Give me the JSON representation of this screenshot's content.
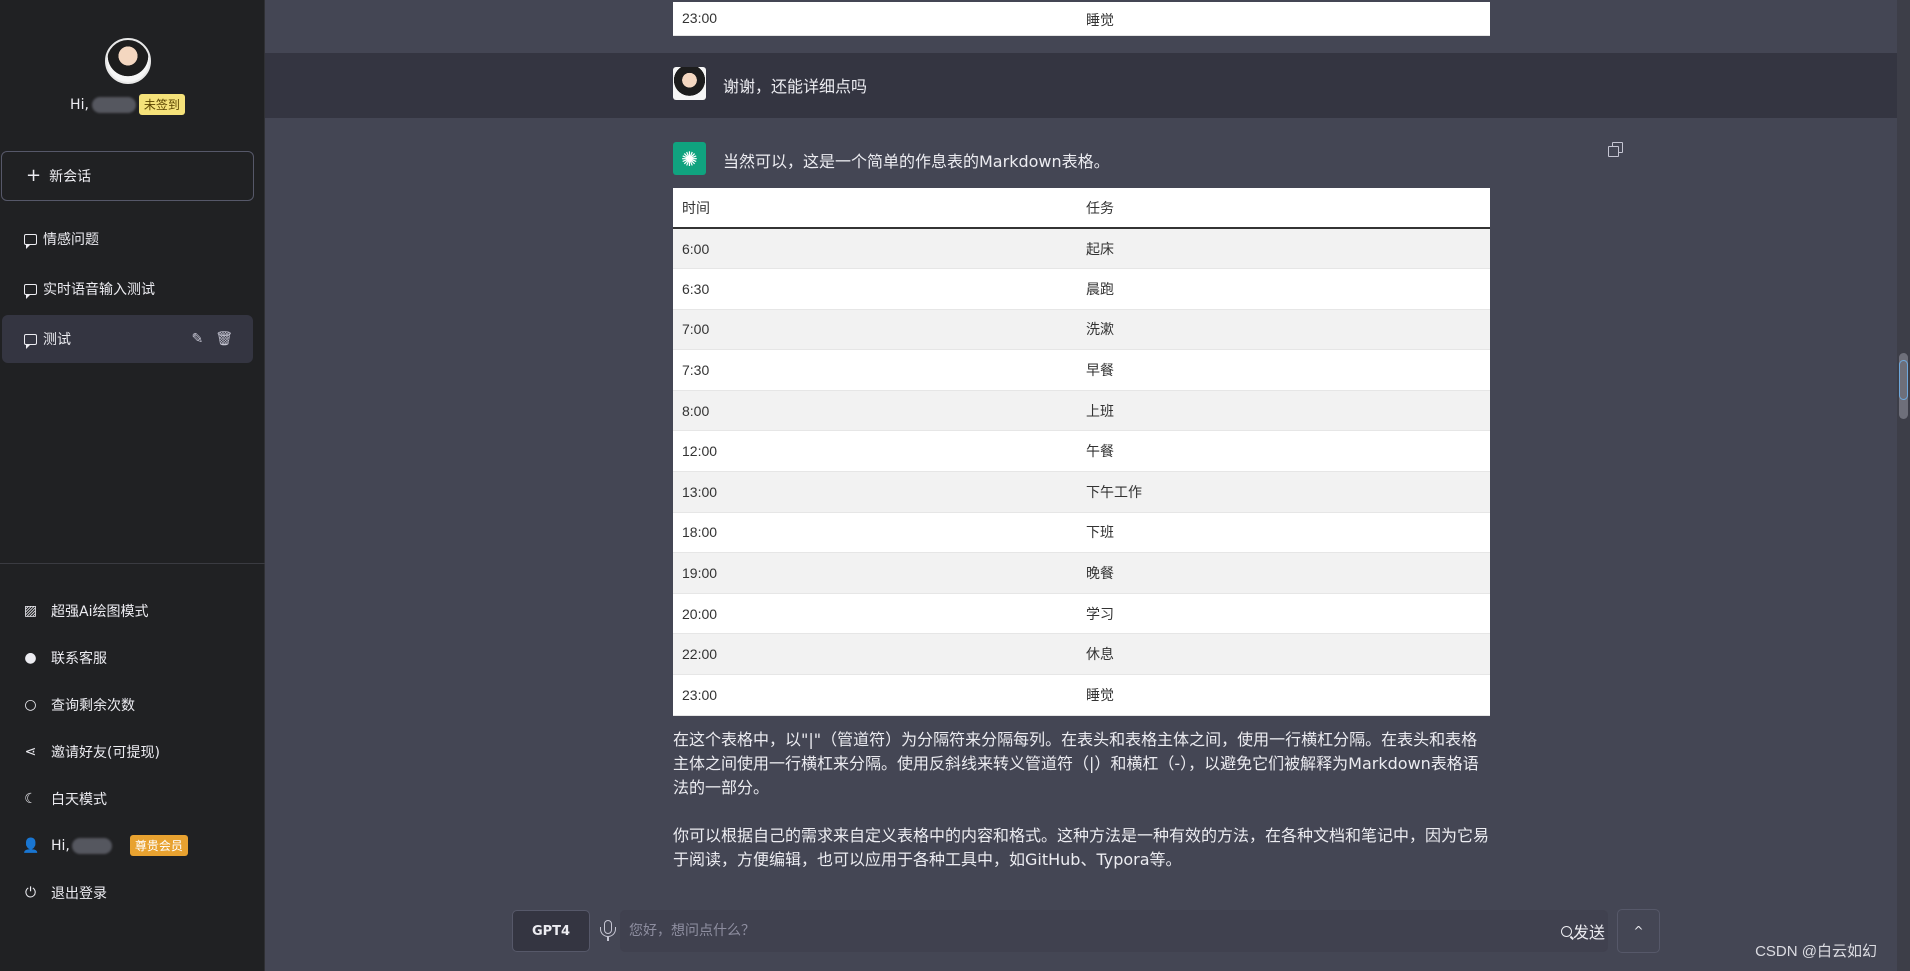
{
  "sidebar": {
    "greeting": "Hi,",
    "checkin_badge": "未签到",
    "new_chat_label": "新会话",
    "conversations": [
      {
        "label": "情感问题"
      },
      {
        "label": "实时语音输入测试"
      },
      {
        "label": "测试",
        "active": true
      }
    ],
    "menu": [
      {
        "label": "超强Ai绘图模式",
        "icon": "image-icon"
      },
      {
        "label": "联系客服",
        "icon": "wechat-icon"
      },
      {
        "label": "查询剩余次数",
        "icon": "search-icon"
      },
      {
        "label": "邀请好友(可提现)",
        "icon": "share-icon"
      },
      {
        "label": "白天模式",
        "icon": "moon-icon"
      },
      {
        "label": "Hi,",
        "icon": "user-icon",
        "badge": "尊贵会员"
      },
      {
        "label": "退出登录",
        "icon": "power-icon"
      }
    ]
  },
  "chat": {
    "prev_row": {
      "time": "23:00",
      "task": "睡觉"
    },
    "user_message": "谢谢，还能详细点吗",
    "ai_intro": "当然可以，这是一个简单的作息表的Markdown表格。",
    "table": {
      "headers": [
        "时间",
        "任务"
      ],
      "rows": [
        [
          "6:00",
          "起床"
        ],
        [
          "6:30",
          "晨跑"
        ],
        [
          "7:00",
          "洗漱"
        ],
        [
          "7:30",
          "早餐"
        ],
        [
          "8:00",
          "上班"
        ],
        [
          "12:00",
          "午餐"
        ],
        [
          "13:00",
          "下午工作"
        ],
        [
          "18:00",
          "下班"
        ],
        [
          "19:00",
          "晚餐"
        ],
        [
          "20:00",
          "学习"
        ],
        [
          "22:00",
          "休息"
        ],
        [
          "23:00",
          "睡觉"
        ]
      ]
    },
    "paragraph1": "在这个表格中，以\"|\"（管道符）为分隔符来分隔每列。在表头和表格主体之间，使用一行横杠分隔。在表头和表格主体之间使用一行横杠来分隔。使用反斜线来转义管道符（|）和横杠（-），以避免它们被解释为Markdown表格语法的一部分。",
    "paragraph2": "你可以根据自己的需求来自定义表格中的内容和格式。这种方法是一种有效的方法，在各种文档和笔记中，因为它易于阅读，方便编辑，也可以应用于各种工具中，如GitHub、Typora等。"
  },
  "input": {
    "model_label": "GPT4",
    "placeholder": "您好，想问点什么？",
    "send_label": "发送",
    "up_label": "^"
  },
  "watermark": "CSDN @白云如幻",
  "colors": {
    "sidebar_bg": "#202123",
    "user_row_bg": "#343541",
    "ai_row_bg": "#444654",
    "gpt_green": "#10a37f",
    "badge_yellow": "#f5e27a",
    "badge_orange": "#e8a230"
  }
}
